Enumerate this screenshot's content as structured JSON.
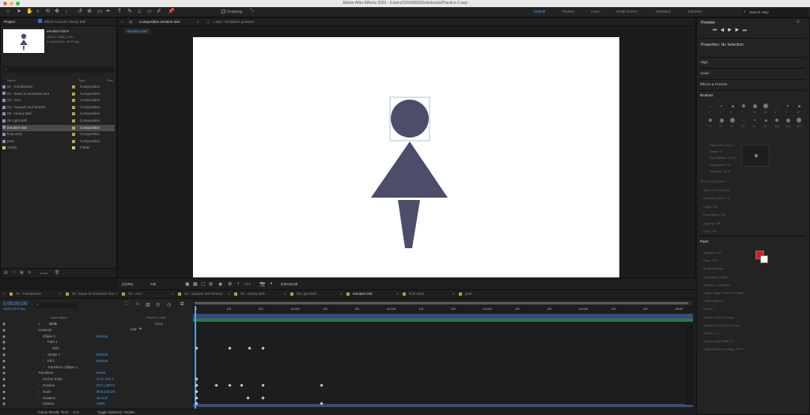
{
  "window_title": "Adobe After Effects 2023 - /Users/21643893/Downloads/Practice-2.aep",
  "toolbar": {
    "snapping_label": "Snapping",
    "workspaces": [
      "Default",
      "Review",
      "Learn",
      "Small Screen",
      "Standard",
      "Libraries"
    ],
    "search_placeholder": "Search Help"
  },
  "project_panel": {
    "tab_label": "Project",
    "effect_controls_tab": "Effect Controls Heavy Ball",
    "selected_name": "emotion trial ▾",
    "selected_info1": "1920 x 1080 (1.00)",
    "selected_info2": "Δ 0;00;05;01, 29.97 fps",
    "search_placeholder": "",
    "col_name": "Name",
    "col_type": "Type",
    "col_size": "Size",
    "items": [
      {
        "name": "01 - Introduction",
        "type": "Composition",
        "color": "#b3a24a"
      },
      {
        "name": "02 - Ease In and Ease Out",
        "type": "Composition",
        "color": "#b3a24a"
      },
      {
        "name": "03 - Arcs",
        "type": "Composition",
        "color": "#b3a24a"
      },
      {
        "name": "04 - Squash and Stretch",
        "type": "Composition",
        "color": "#b3a24a"
      },
      {
        "name": "05 - Heavy Ball",
        "type": "Composition",
        "color": "#b3a24a"
      },
      {
        "name": "06 Light Ball",
        "type": "Composition",
        "color": "#b3a24a"
      },
      {
        "name": "emotion trial",
        "type": "Composition",
        "color": "#b3a24a",
        "selected": true
      },
      {
        "name": "final anim",
        "type": "Composition",
        "color": "#b3a24a"
      },
      {
        "name": "pear",
        "type": "Composition",
        "color": "#b3a24a"
      },
      {
        "name": "Solids",
        "type": "Folder",
        "color": "#d9c36a"
      }
    ],
    "bpc": "8 bpc"
  },
  "comp_panel": {
    "tab_label": "Composition emotion trial",
    "layer_tab": "Layer: inkSplash gradient",
    "sub_tab": "emotion trial",
    "zoom": "(123%)",
    "resolution": "Full",
    "exposure": "+0.0",
    "timecode": "0;00;00;00"
  },
  "right_panel": {
    "preview_label": "Preview",
    "properties_label": "Properties: No Selection",
    "sections": [
      "Align",
      "Audio",
      "Effects & Presets",
      "Brushes"
    ],
    "brush_sizes": [
      "1",
      "3",
      "5",
      "9",
      "13",
      "19",
      "5",
      "9",
      "13",
      "17",
      "21",
      "27",
      "35",
      "45",
      "65",
      "100",
      "200",
      "300"
    ],
    "brush_props": [
      "Diameter: 13 px",
      "Angle: 0°",
      "Roundness: 100 %",
      "Hardness: 0 %",
      "Spacing: 25 %"
    ],
    "dynamics_label": "Brush Dynamics",
    "dynamics": [
      "Size: Pen Pressure",
      "Minimum Size: 1 %",
      "Angle: Off",
      "Roundness: Off",
      "Opacity: Off",
      "Flow: Off"
    ],
    "paint_label": "Paint",
    "paint_props": [
      "Opacity: 0 %",
      "Flow: 0 %",
      "Mode: Normal",
      "Channels: RGBA",
      "Duration: Constant",
      "Erase: Layer Source & Paint",
      "Clone Options",
      "Preset:",
      "Source: Current Layer",
      "Aligned   Lock Source Time",
      "Offset: 0 , 0",
      "Source Time Shift: 0 f",
      "Clone Source Overlay: 50 %"
    ],
    "fg_color": "#e11818",
    "bg_color": "#ffffff"
  },
  "timeline": {
    "tabs": [
      "01 - Introduction",
      "02 - Ease In and Ease Out",
      "03 - Arcs",
      "04 - Squash and Stretch",
      "05 - Heavy Ball",
      "06 Light Ball",
      "emotion trial",
      "final anim",
      "pear"
    ],
    "active_tab": "emotion trial",
    "timecode": "0;00;00;00",
    "fps_info": "00000 (29.97 fps)",
    "col_layer_name": "Layer Name",
    "col_parent": "Parent & Link",
    "ruler": [
      "0f",
      "10f",
      "20f",
      "01:00f",
      "10f",
      "20f",
      "02:00f",
      "10f",
      "20f",
      "03:00f",
      "10f",
      "20f",
      "04:00f",
      "10f",
      "20f",
      "05:00"
    ],
    "layers": [
      {
        "label": "1",
        "name": "circle",
        "parent": "None",
        "indent": 0
      },
      {
        "label": "",
        "name": "Contents",
        "value": "",
        "indent": 1
      },
      {
        "label": "",
        "name": "Ellipse 1",
        "value": "Normal",
        "indent": 2
      },
      {
        "label": "",
        "name": "Path 1",
        "value": "",
        "indent": 3
      },
      {
        "label": "",
        "name": "Path",
        "value": "",
        "indent": 4
      },
      {
        "label": "",
        "name": "Stroke 1",
        "value": "Normal",
        "indent": 3
      },
      {
        "label": "",
        "name": "Fill 1",
        "value": "Normal",
        "indent": 3
      },
      {
        "label": "",
        "name": "Transform: Ellipse 1",
        "value": "",
        "indent": 3
      },
      {
        "label": "",
        "name": "Transform",
        "value": "Reset",
        "indent": 1
      },
      {
        "label": "",
        "name": "Anchor Point",
        "value": "17.1,-172.7",
        "indent": 2
      },
      {
        "label": "",
        "name": "Position",
        "value": "977.1,367.3",
        "indent": 2
      },
      {
        "label": "",
        "name": "Scale",
        "value": "90.5,103.3%",
        "indent": 2
      },
      {
        "label": "",
        "name": "Rotation",
        "value": "0x+0.0°",
        "indent": 2
      },
      {
        "label": "",
        "name": "Opacity",
        "value": "100%",
        "indent": 2
      }
    ],
    "add_label": "Add:",
    "footer_render": "Frame Render Time:",
    "footer_render_value": "3ms",
    "footer_toggle": "Toggle Switches / Modes"
  }
}
